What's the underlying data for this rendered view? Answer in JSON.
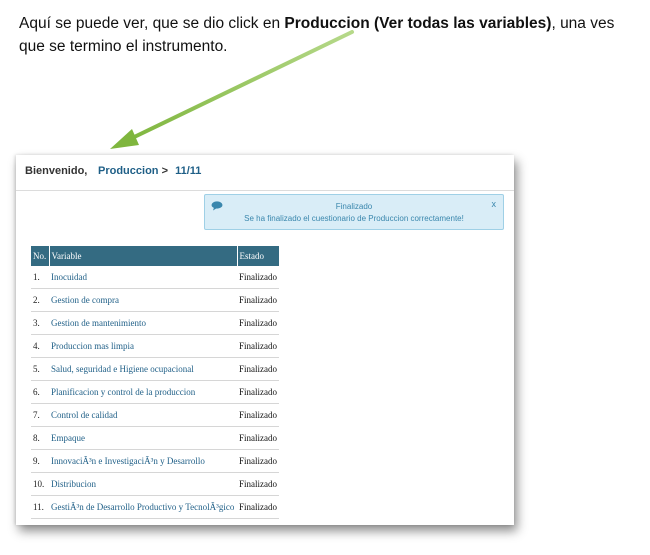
{
  "caption": {
    "line1_a": "Aquí se puede ver, que se dio click en ",
    "line1_bold": "Produccion (Ver todas las variables)",
    "line1_b": ", una ves",
    "line2": "que se termino el instrumento."
  },
  "header": {
    "welcome": "Bienvenido,",
    "breadcrumb_link": "Produccion",
    "separator": ">",
    "progress": "11/11"
  },
  "alert": {
    "title": "Finalizado",
    "message": "Se ha finalizado el cuestionario de Produccion correctamente!",
    "close": "x",
    "icon": "speech-bubble-icon"
  },
  "table": {
    "headers": [
      "No.",
      "Variable",
      "Estado"
    ],
    "rows": [
      {
        "no": "1.",
        "variable": "Inocuidad",
        "estado": "Finalizado"
      },
      {
        "no": "2.",
        "variable": "Gestion de compra",
        "estado": "Finalizado"
      },
      {
        "no": "3.",
        "variable": "Gestion de mantenimiento",
        "estado": "Finalizado"
      },
      {
        "no": "4.",
        "variable": "Produccion mas limpia",
        "estado": "Finalizado"
      },
      {
        "no": "5.",
        "variable": "Salud, seguridad e Higiene ocupacional",
        "estado": "Finalizado"
      },
      {
        "no": "6.",
        "variable": "Planificacion y control de la produccion",
        "estado": "Finalizado"
      },
      {
        "no": "7.",
        "variable": "Control de calidad",
        "estado": "Finalizado"
      },
      {
        "no": "8.",
        "variable": "Empaque",
        "estado": "Finalizado"
      },
      {
        "no": "9.",
        "variable": "InnovaciÃ³n e InvestigaciÃ³n y Desarrollo",
        "estado": "Finalizado"
      },
      {
        "no": "10.",
        "variable": "Distribucion",
        "estado": "Finalizado"
      },
      {
        "no": "11.",
        "variable": "GestiÃ³n de Desarrollo Productivo y TecnolÃ³gico",
        "estado": "Finalizado"
      }
    ]
  },
  "colors": {
    "arrow": "#8cc04b",
    "header_bg": "#346b82",
    "link": "#1f5f87",
    "alert_bg": "#d9edf7"
  }
}
